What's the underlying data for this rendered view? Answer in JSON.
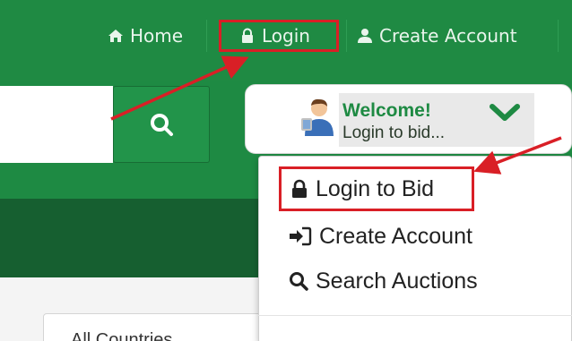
{
  "nav": {
    "home_label": "Home",
    "login_label": "Login",
    "create_account_label": "Create Account"
  },
  "welcome": {
    "title": "Welcome!",
    "subtitle": "Login to bid..."
  },
  "dropdown": {
    "items": [
      {
        "label": "Login to Bid",
        "icon": "lock-icon"
      },
      {
        "label": "Create Account",
        "icon": "sign-in-icon"
      },
      {
        "label": "Search Auctions",
        "icon": "search-icon"
      }
    ]
  },
  "filter": {
    "country_value": "All Countries"
  },
  "colors": {
    "brand_green": "#1f8a43",
    "dark_green": "#165f30",
    "highlight_red": "#d91f26"
  }
}
